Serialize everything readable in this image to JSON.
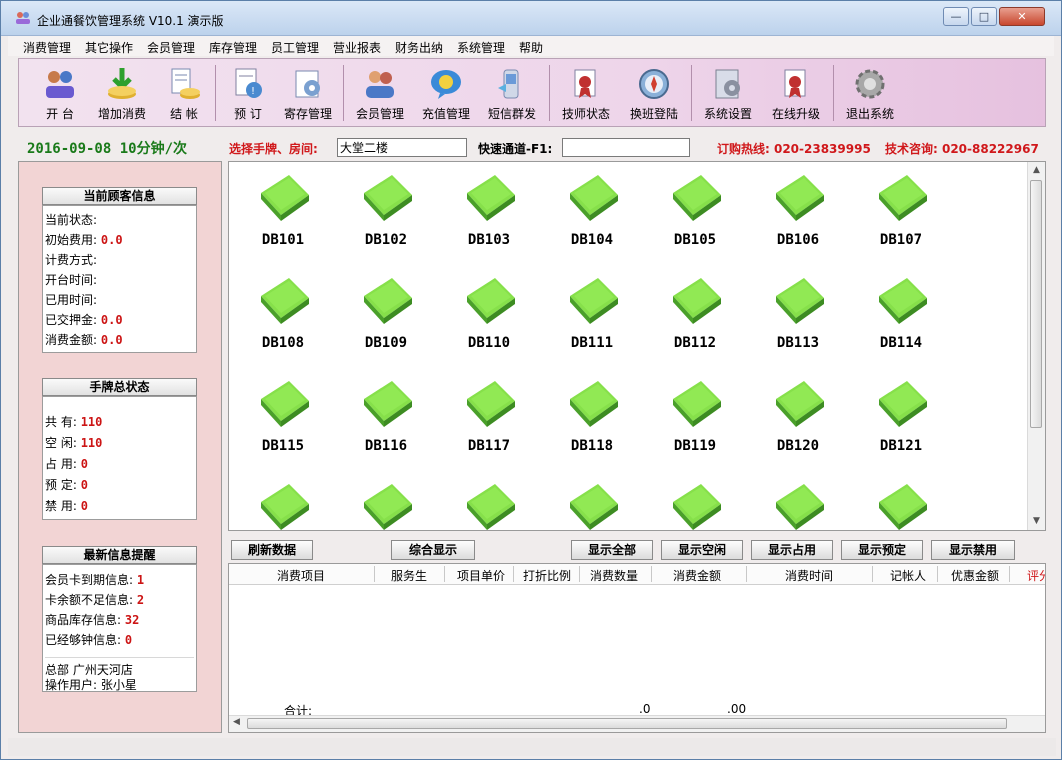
{
  "window": {
    "title": "企业通餐饮管理系统 V10.1  演示版"
  },
  "menubar": {
    "items": [
      "消费管理",
      "其它操作",
      "会员管理",
      "库存管理",
      "员工管理",
      "营业报表",
      "财务出纳",
      "系统管理",
      "帮助"
    ]
  },
  "toolbar": {
    "buttons": [
      {
        "label": "开  台",
        "icon": "open-table-icon"
      },
      {
        "label": "增加消费",
        "icon": "add-consume-icon"
      },
      {
        "label": "结  帐",
        "icon": "checkout-icon"
      },
      {
        "label": "预  订",
        "icon": "reserve-icon"
      },
      {
        "label": "寄存管理",
        "icon": "storage-icon"
      },
      {
        "label": "会员管理",
        "icon": "member-icon"
      },
      {
        "label": "充值管理",
        "icon": "recharge-icon"
      },
      {
        "label": "短信群发",
        "icon": "sms-icon"
      },
      {
        "label": "技师状态",
        "icon": "technician-icon"
      },
      {
        "label": "换班登陆",
        "icon": "shift-icon"
      },
      {
        "label": "系统设置",
        "icon": "settings-icon"
      },
      {
        "label": "在线升级",
        "icon": "upgrade-icon"
      },
      {
        "label": "退出系统",
        "icon": "exit-icon"
      }
    ]
  },
  "infobar": {
    "date_rate": "2016-09-08  10分钟/次",
    "select_label": "选择手牌、房间:",
    "select_value": "大堂二楼",
    "quick_label": "快速通道-F1:",
    "quick_value": "",
    "hotline": "订购热线:  020-23839995",
    "tech": "技术咨询:  020-88222967"
  },
  "current_customer": {
    "heading": "当前顾客信息",
    "rows": [
      {
        "label": "当前状态:",
        "value": ""
      },
      {
        "label": "初始费用:",
        "value": "0.0"
      },
      {
        "label": "计费方式:",
        "value": ""
      },
      {
        "label": "开台时间:",
        "value": ""
      },
      {
        "label": "已用时间:",
        "value": ""
      },
      {
        "label": "已交押金:",
        "value": "0.0"
      },
      {
        "label": "消费金额:",
        "value": "0.0"
      }
    ]
  },
  "tag_status": {
    "heading": "手牌总状态",
    "rows": [
      {
        "label": "共    有:",
        "value": "110"
      },
      {
        "label": "空    闲:",
        "value": "110"
      },
      {
        "label": "占    用:",
        "value": "0"
      },
      {
        "label": "预    定:",
        "value": "0"
      },
      {
        "label": "禁    用:",
        "value": "0"
      }
    ]
  },
  "latest_info": {
    "heading": "最新信息提醒",
    "rows": [
      {
        "label": "会员卡到期信息:",
        "value": "1"
      },
      {
        "label": "卡余额不足信息:",
        "value": "2"
      },
      {
        "label": "商品库存信息:",
        "value": "32"
      },
      {
        "label": "已经够钟信息:",
        "value": "0"
      }
    ],
    "branch": "总部    广州天河店",
    "operator": "操作用户: 张小星"
  },
  "tiles": [
    "DB101",
    "DB102",
    "DB103",
    "DB104",
    "DB105",
    "DB106",
    "DB107",
    "DB108",
    "DB109",
    "DB110",
    "DB111",
    "DB112",
    "DB113",
    "DB114",
    "DB115",
    "DB116",
    "DB117",
    "DB118",
    "DB119",
    "DB120",
    "DB121",
    "",
    "",
    "",
    "",
    "",
    "",
    ""
  ],
  "actions": {
    "refresh": "刷新数据",
    "summary": "综合显示",
    "show_all": "显示全部",
    "show_free": "显示空闲",
    "show_used": "显示占用",
    "show_reserved": "显示预定",
    "show_disabled": "显示禁用"
  },
  "table": {
    "columns": [
      "消费项目",
      "服务生",
      "项目单价",
      "打折比例",
      "消费数量",
      "消费金额",
      "消费时间",
      "记帐人",
      "优惠金额",
      "评分"
    ],
    "total_label": "合计:",
    "total_qty": ".0",
    "total_amount": ".00"
  },
  "colors": {
    "tile_green": "#6fd23a",
    "red_text": "#d0181b",
    "date_green": "#1a7a1a"
  }
}
